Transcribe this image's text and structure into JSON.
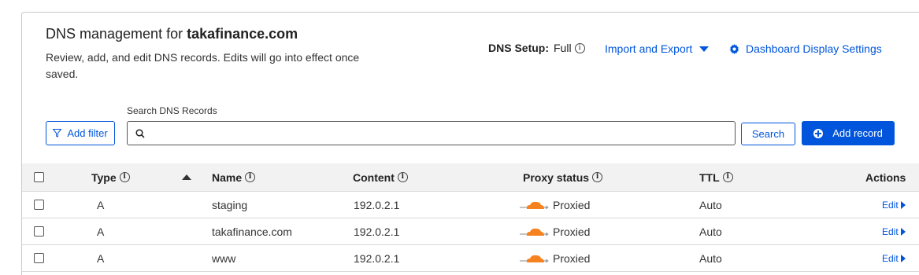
{
  "header": {
    "title_prefix": "DNS management for",
    "domain": "takafinance.com",
    "description": "Review, add, and edit DNS records. Edits will go into effect once saved."
  },
  "setup": {
    "label": "DNS Setup:",
    "value": "Full"
  },
  "links": {
    "import_export": "Import and Export",
    "dashboard_settings": "Dashboard Display Settings"
  },
  "toolbar": {
    "search_label": "Search DNS Records",
    "search_placeholder": "",
    "add_filter": "Add filter",
    "search_button": "Search",
    "add_record": "Add record"
  },
  "table": {
    "headers": {
      "type": "Type",
      "name": "Name",
      "content": "Content",
      "proxy": "Proxy status",
      "ttl": "TTL",
      "actions": "Actions"
    },
    "rows": [
      {
        "type": "A",
        "name": "staging",
        "content": "192.0.2.1",
        "proxy": "Proxied",
        "ttl": "Auto",
        "action": "Edit"
      },
      {
        "type": "A",
        "name": "takafinance.com",
        "content": "192.0.2.1",
        "proxy": "Proxied",
        "ttl": "Auto",
        "action": "Edit"
      },
      {
        "type": "A",
        "name": "www",
        "content": "192.0.2.1",
        "proxy": "Proxied",
        "ttl": "Auto",
        "action": "Edit"
      }
    ]
  },
  "colors": {
    "accent": "#0055dc",
    "cloud": "#f6821f",
    "header_bg": "#f2f2f2"
  }
}
